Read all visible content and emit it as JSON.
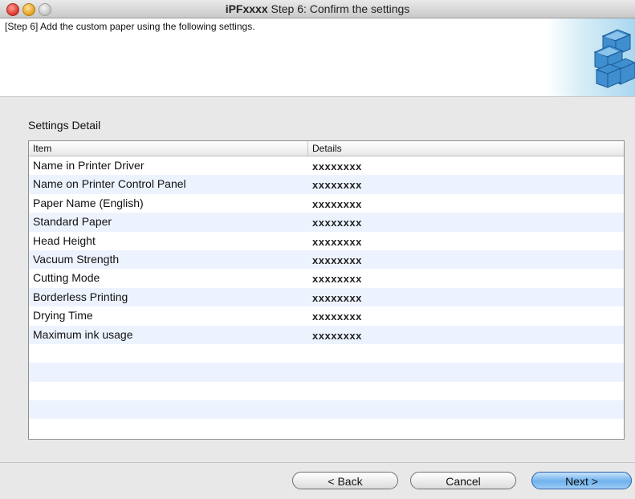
{
  "window": {
    "title_model": "iPFxxxx",
    "title_rest": " Step 6: Confirm the settings"
  },
  "header": {
    "instruction": "[Step 6] Add the custom paper using the following settings."
  },
  "section": {
    "title": "Settings Detail"
  },
  "table": {
    "columns": [
      "Item",
      "Details"
    ],
    "rows": [
      {
        "item": "Name in Printer Driver",
        "details": "xxxxxxxx"
      },
      {
        "item": "Name on Printer Control Panel",
        "details": "xxxxxxxx"
      },
      {
        "item": "Paper Name (English)",
        "details": "xxxxxxxx"
      },
      {
        "item": "Standard Paper",
        "details": "xxxxxxxx"
      },
      {
        "item": "Head Height",
        "details": "xxxxxxxx"
      },
      {
        "item": "Vacuum Strength",
        "details": "xxxxxxxx"
      },
      {
        "item": "Cutting Mode",
        "details": "xxxxxxxx"
      },
      {
        "item": "Borderless Printing",
        "details": "xxxxxxxx"
      },
      {
        "item": "Drying Time",
        "details": "xxxxxxxx"
      },
      {
        "item": "Maximum ink usage",
        "details": "xxxxxxxx"
      },
      {
        "item": "",
        "details": ""
      },
      {
        "item": "",
        "details": ""
      },
      {
        "item": "",
        "details": ""
      },
      {
        "item": "",
        "details": ""
      },
      {
        "item": "",
        "details": ""
      }
    ]
  },
  "buttons": {
    "back": "< Back",
    "cancel": "Cancel",
    "next": "Next >"
  },
  "colors": {
    "default_button": "#6fb1ec",
    "row_stripe": "#edf3fe"
  },
  "icons": {
    "header_art": "stacked-paper-cubes-graphic"
  }
}
